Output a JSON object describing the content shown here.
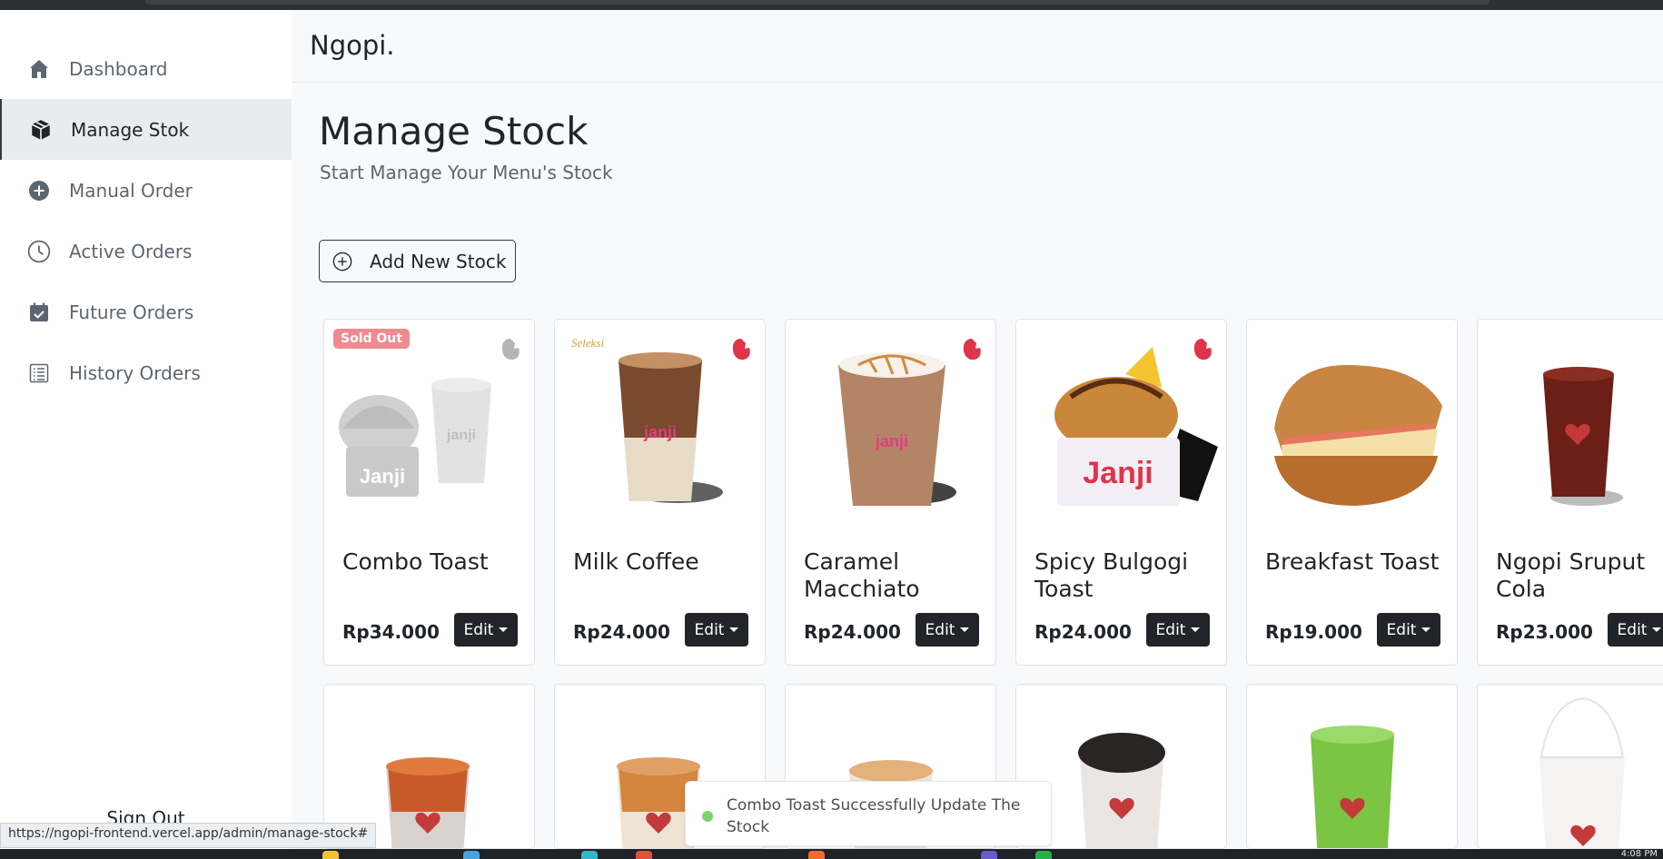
{
  "app": {
    "brand": "Ngopi."
  },
  "sidebar": {
    "items": [
      {
        "label": "Dashboard",
        "icon": "home-icon",
        "active": false
      },
      {
        "label": "Manage Stok",
        "icon": "box-icon",
        "active": true
      },
      {
        "label": "Manual Order",
        "icon": "plus-circle-icon",
        "active": false
      },
      {
        "label": "Active Orders",
        "icon": "clock-icon",
        "active": false
      },
      {
        "label": "Future Orders",
        "icon": "calendar-check-icon",
        "active": false
      },
      {
        "label": "History Orders",
        "icon": "list-icon",
        "active": false
      }
    ],
    "signout": "Sign Out"
  },
  "main": {
    "title": "Manage Stock",
    "subtitle": "Start Manage Your Menu's Stock",
    "add_button": "Add New Stock"
  },
  "products": [
    {
      "name": "Combo Toast",
      "price": "Rp34.000",
      "edit": "Edit",
      "sold_out": true,
      "badge": "Sold Out"
    },
    {
      "name": "Milk Coffee",
      "price": "Rp24.000",
      "edit": "Edit"
    },
    {
      "name": "Caramel Macchiato",
      "price": "Rp24.000",
      "edit": "Edit"
    },
    {
      "name": "Spicy Bulgogi Toast",
      "price": "Rp24.000",
      "edit": "Edit"
    },
    {
      "name": "Breakfast Toast",
      "price": "Rp19.000",
      "edit": "Edit"
    },
    {
      "name": "Ngopi Sruput Cola",
      "price": "Rp23.000",
      "edit": "Edit"
    }
  ],
  "toast": {
    "message": "Combo Toast Successfully Update The Stock"
  },
  "status_url": "https://ngopi-frontend.vercel.app/admin/manage-stock#",
  "taskbar": {
    "clock": "4:08 PM"
  },
  "colors": {
    "accent": "#212529",
    "active_bg": "#e9ecef",
    "sold_out": "#f08a8f",
    "toast_dot": "#7ad26b",
    "brand_mark": "#e0344a"
  }
}
